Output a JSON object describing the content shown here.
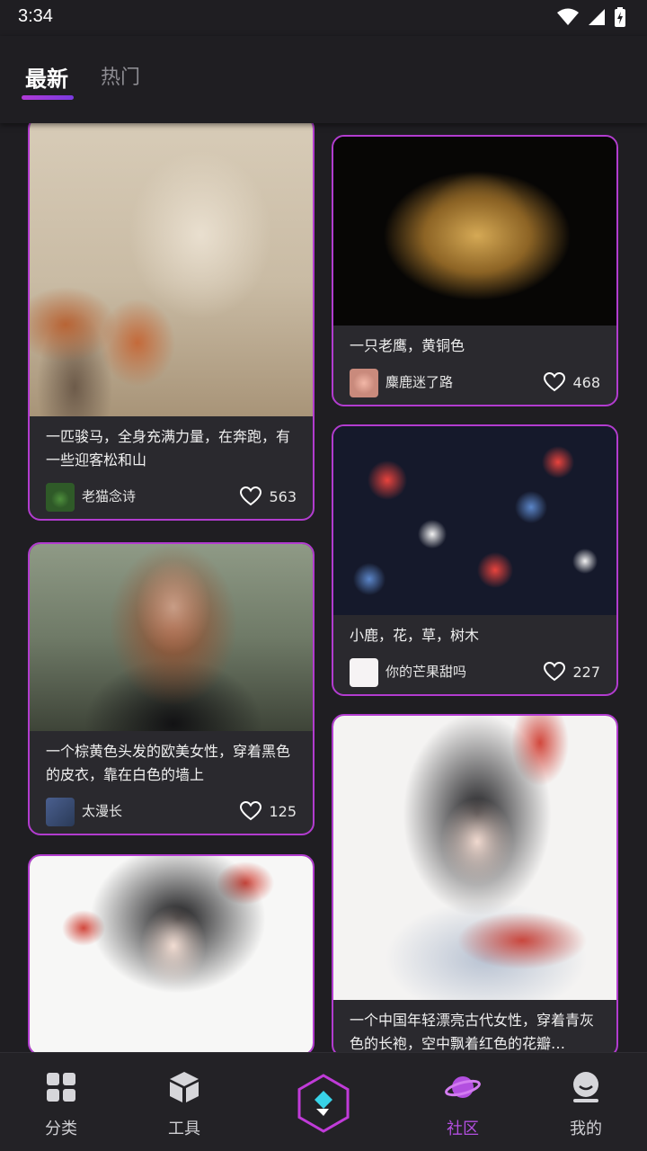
{
  "status": {
    "time": "3:34"
  },
  "tabs": [
    {
      "label": "最新",
      "active": true
    },
    {
      "label": "热门",
      "active": false
    }
  ],
  "cards": [
    {
      "title": "一匹骏马，全身充满力量，在奔跑，有一些迎客松和山",
      "author": "老猫念诗",
      "likes": "563"
    },
    {
      "title": "一只老鹰，黄铜色",
      "author": "麋鹿迷了路",
      "likes": "468"
    },
    {
      "title": "一个棕黄色头发的欧美女性，穿着黑色的皮衣，靠在白色的墙上",
      "author": "太漫长",
      "likes": "125"
    },
    {
      "title": "小鹿，花，草，树木",
      "author": "你的芒果甜吗",
      "likes": "227"
    },
    {
      "title": "一个中国年轻漂亮古代女性，穿着青灰色的长袍，空中飘着红色的花瓣…",
      "author": "",
      "likes": ""
    },
    {
      "title": "",
      "author": "",
      "likes": ""
    }
  ],
  "nav": [
    {
      "label": "分类",
      "icon": "category-grid-icon",
      "active": false
    },
    {
      "label": "工具",
      "icon": "cube-icon",
      "active": false
    },
    {
      "label": "",
      "icon": "create-hexagon-icon",
      "active": false
    },
    {
      "label": "社区",
      "icon": "planet-icon",
      "active": true
    },
    {
      "label": "我的",
      "icon": "profile-icon",
      "active": false
    }
  ],
  "colors": {
    "accent": "#b23ccf",
    "background": "#1f1e22",
    "card": "#2a292e"
  }
}
